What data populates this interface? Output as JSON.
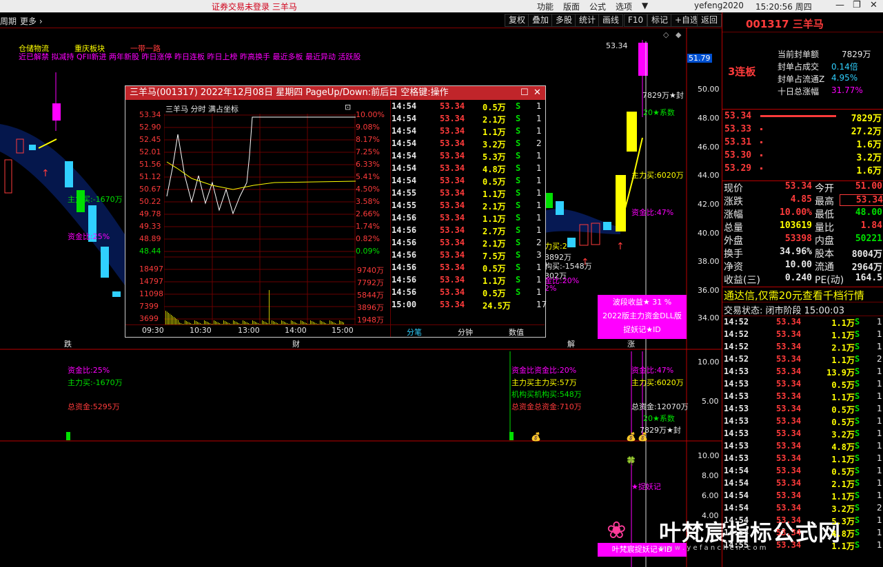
{
  "titlebar": {
    "title": "证券交易未登录  三羊马",
    "menu": [
      "功能",
      "版面",
      "公式",
      "选项"
    ],
    "user": "yefeng2020",
    "clock": "15:20:56 周四",
    "min": "—",
    "max": "❐",
    "close": "✕"
  },
  "toolbar": {
    "period": "周期",
    "more": "更多 ›",
    "buttons": [
      "复权",
      "叠加",
      "多股",
      "统计",
      "画线",
      "F10",
      "标记",
      "+自选",
      "返回"
    ]
  },
  "header": {
    "sectors": [
      "仓储物流",
      "重庆板块",
      "一带一路"
    ],
    "tags": "近已解禁 拟减持 QFII新进 两年新股 昨日涨停 昨日连板 昨日上榜 昨高换手 最近多板 最近异动 活跃股"
  },
  "yaxis": [
    "50.00",
    "48.00",
    "46.00",
    "44.00",
    "42.00",
    "40.00",
    "38.00",
    "36.00",
    "34.00"
  ],
  "current_price_tag": "51.79",
  "high_label": "53.34",
  "chart_labels": {
    "seal": "7829万★封",
    "xishu": "20★系数",
    "zhulimai1": "主力买:-1670万",
    "zijinbi1": "资金比:25%",
    "zhulimai2": "主力买:6020万",
    "zijinbi2": "资金比:47%",
    "zhulimai3": "力买:2",
    "jigou": "构买:-1548万",
    "p892": "3892万",
    "p302": "302万",
    "zjb20": "金比:20%",
    "pct2": "2%",
    "die": "跌",
    "cai": "财",
    "jie": "解",
    "zhang": "涨"
  },
  "infobox": {
    "l1": "波段收益★ 31  %",
    "l2": "2022版主力资金DLL版",
    "l3": "捉妖记★ID"
  },
  "sub1": {
    "yaxis": [
      "10.00",
      "5.00"
    ],
    "zijinbi": "资金比:25%",
    "zhulimai": "主力买:-1670万",
    "zongzijin": "总资金:5295万",
    "mid1": "资金比资金比:20%",
    "mid2": "主力买主力买:57万",
    "mid3": "机构买机构买:548万",
    "mid4": "总资金总资金:710万",
    "r1": "资金比:47%",
    "r2": "主力买:6020万",
    "r3": "总资金:12070万",
    "r4": "20★系数",
    "r5": "7829万★封"
  },
  "sub2": {
    "yaxis": [
      "10.00",
      "8.00",
      "6.00",
      "4.00"
    ],
    "zhuoyao": "★捉妖记",
    "bottombox": "叶梵宸捉妖记★ID"
  },
  "watermark": {
    "text": "叶梵宸指标公式网",
    "url": "w w w . y e f a n c h e n . c o m"
  },
  "right": {
    "code": "001317 三羊马",
    "seal": [
      {
        "k": "当前封单额",
        "v": "7829万"
      },
      {
        "k": "封单占成交",
        "v": "0.14倍"
      },
      {
        "k": "封单占流通Z",
        "v": "4.95%"
      },
      {
        "k": "十日总涨幅",
        "v": "31.77%"
      }
    ],
    "streak": "3连板",
    "orderbook": [
      {
        "p": "53.34",
        "v": "7829万"
      },
      {
        "p": "53.33",
        "v": "27.2万"
      },
      {
        "p": "53.31",
        "v": "1.6万"
      },
      {
        "p": "53.30",
        "v": "3.2万"
      },
      {
        "p": "53.29",
        "v": "1.6万"
      }
    ],
    "quote": [
      {
        "k1": "现价",
        "v1": "53.34",
        "k2": "今开",
        "v2": "51.00"
      },
      {
        "k1": "涨跌",
        "v1": "4.85",
        "k2": "最高",
        "v2": "53.34"
      },
      {
        "k1": "涨幅",
        "v1": "10.00%",
        "k2": "最低",
        "v2": "48.00"
      },
      {
        "k1": "总量",
        "v1": "103619",
        "k2": "量比",
        "v2": "1.84"
      },
      {
        "k1": "外盘",
        "v1": "53398",
        "k2": "内盘",
        "v2": "50221"
      },
      {
        "k1": "换手",
        "v1": "34.96%",
        "k2": "股本",
        "v2": "8004万"
      },
      {
        "k1": "净资",
        "v1": "10.00",
        "k2": "流通",
        "v2": "2964万"
      },
      {
        "k1": "收益(三)",
        "v1": "0.240",
        "k2": "PE(动)",
        "v2": "164.5"
      }
    ],
    "banner": "通达信,仅需20元查看千档行情",
    "status": "交易状态: 闭市阶段 15:00:03",
    "ticks": [
      {
        "t": "14:52",
        "p": "53.34",
        "v": "1.1万",
        "s": "S",
        "n": "1"
      },
      {
        "t": "14:52",
        "p": "53.34",
        "v": "1.1万",
        "s": "S",
        "n": "1"
      },
      {
        "t": "14:52",
        "p": "53.34",
        "v": "2.1万",
        "s": "S",
        "n": "1"
      },
      {
        "t": "14:52",
        "p": "53.34",
        "v": "1.1万",
        "s": "S",
        "n": "2"
      },
      {
        "t": "14:53",
        "p": "53.34",
        "v": "13.9万",
        "s": "S",
        "n": "1"
      },
      {
        "t": "14:53",
        "p": "53.34",
        "v": "0.5万",
        "s": "S",
        "n": "1"
      },
      {
        "t": "14:53",
        "p": "53.34",
        "v": "1.1万",
        "s": "S",
        "n": "1"
      },
      {
        "t": "14:53",
        "p": "53.34",
        "v": "0.5万",
        "s": "S",
        "n": "1"
      },
      {
        "t": "14:53",
        "p": "53.34",
        "v": "0.5万",
        "s": "S",
        "n": "1"
      },
      {
        "t": "14:53",
        "p": "53.34",
        "v": "3.2万",
        "s": "S",
        "n": "1"
      },
      {
        "t": "14:53",
        "p": "53.34",
        "v": "4.8万",
        "s": "S",
        "n": "1"
      },
      {
        "t": "14:53",
        "p": "53.34",
        "v": "1.1万",
        "s": "S",
        "n": "1"
      },
      {
        "t": "14:54",
        "p": "53.34",
        "v": "0.5万",
        "s": "S",
        "n": "1"
      },
      {
        "t": "14:54",
        "p": "53.34",
        "v": "2.1万",
        "s": "S",
        "n": "1"
      },
      {
        "t": "14:54",
        "p": "53.34",
        "v": "1.1万",
        "s": "S",
        "n": "1"
      },
      {
        "t": "14:54",
        "p": "53.34",
        "v": "3.2万",
        "s": "S",
        "n": "2"
      },
      {
        "t": "14:54",
        "p": "53.34",
        "v": "5.3万",
        "s": "S",
        "n": "1"
      },
      {
        "t": "14:54",
        "p": "53.34",
        "v": "4.8万",
        "s": "S",
        "n": "1"
      },
      {
        "t": "14:55",
        "p": "53.34",
        "v": "1.1万",
        "s": "S",
        "n": "1"
      }
    ]
  },
  "popup": {
    "title": "三羊马(001317) 2022年12月08日 星期四 PageUp/Down:前后日 空格键:操作",
    "sub": "三羊马  分时  满占坐标",
    "prices": [
      "53.34",
      "52.90",
      "52.45",
      "52.01",
      "51.56",
      "51.12",
      "50.67",
      "50.22",
      "49.78",
      "49.33",
      "48.89",
      "48.44"
    ],
    "pcts": [
      "10.00%",
      "9.08%",
      "8.17%",
      "7.25%",
      "6.33%",
      "5.41%",
      "4.50%",
      "3.58%",
      "2.66%",
      "1.74%",
      "0.82%",
      "0.09%"
    ],
    "vols": [
      "18497",
      "14797",
      "11098",
      "7399",
      "3699"
    ],
    "volr": [
      "9740万",
      "7792万",
      "5844万",
      "3896万",
      "1948万"
    ],
    "times": [
      "09:30",
      "10:30",
      "13:00",
      "14:00",
      "15:00"
    ],
    "ticks": [
      {
        "t": "14:54",
        "p": "53.34",
        "v": "0.5万",
        "s": "S",
        "n": "1"
      },
      {
        "t": "14:54",
        "p": "53.34",
        "v": "2.1万",
        "s": "S",
        "n": "1"
      },
      {
        "t": "14:54",
        "p": "53.34",
        "v": "1.1万",
        "s": "S",
        "n": "1"
      },
      {
        "t": "14:54",
        "p": "53.34",
        "v": "3.2万",
        "s": "S",
        "n": "2"
      },
      {
        "t": "14:54",
        "p": "53.34",
        "v": "5.3万",
        "s": "S",
        "n": "1"
      },
      {
        "t": "14:54",
        "p": "53.34",
        "v": "4.8万",
        "s": "S",
        "n": "1"
      },
      {
        "t": "14:54",
        "p": "53.34",
        "v": "0.5万",
        "s": "S",
        "n": "1"
      },
      {
        "t": "14:55",
        "p": "53.34",
        "v": "1.1万",
        "s": "S",
        "n": "1"
      },
      {
        "t": "14:55",
        "p": "53.34",
        "v": "2.1万",
        "s": "S",
        "n": "1"
      },
      {
        "t": "14:56",
        "p": "53.34",
        "v": "1.1万",
        "s": "S",
        "n": "1"
      },
      {
        "t": "14:56",
        "p": "53.34",
        "v": "2.7万",
        "s": "S",
        "n": "1"
      },
      {
        "t": "14:56",
        "p": "53.34",
        "v": "2.1万",
        "s": "S",
        "n": "2"
      },
      {
        "t": "14:56",
        "p": "53.34",
        "v": "7.5万",
        "s": "S",
        "n": "3"
      },
      {
        "t": "14:56",
        "p": "53.34",
        "v": "0.5万",
        "s": "S",
        "n": "1"
      },
      {
        "t": "14:56",
        "p": "53.34",
        "v": "1.1万",
        "s": "S",
        "n": "1"
      },
      {
        "t": "14:56",
        "p": "53.34",
        "v": "0.5万",
        "s": "S",
        "n": "1"
      },
      {
        "t": "15:00",
        "p": "53.34",
        "v": "24.5万",
        "s": "",
        "n": "17"
      }
    ],
    "tabs": [
      "分笔",
      "分钟",
      "数值"
    ]
  }
}
